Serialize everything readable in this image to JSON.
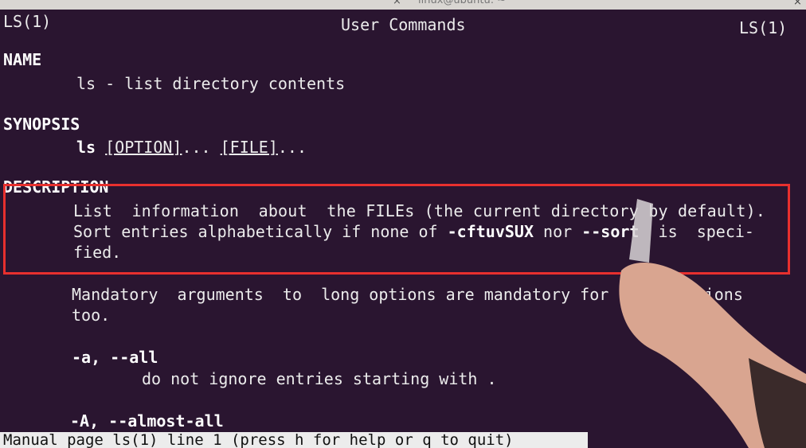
{
  "window": {
    "title": "linux@ubuntu: ~",
    "tab_close_glyph": "×",
    "close_glyph": "×"
  },
  "header": {
    "left": "LS(1)",
    "center": "User Commands",
    "right": "LS(1)"
  },
  "name_section": {
    "heading": "NAME",
    "text": "ls - list directory contents"
  },
  "synopsis": {
    "heading": "SYNOPSIS",
    "cmd": "ls",
    "option": "[OPTION]",
    "dots1": "...",
    "file": "[FILE]",
    "dots2": "..."
  },
  "description": {
    "heading": "DESCRIPTION",
    "line1": "List  information  about  the FILEs (the current directory by default).",
    "line2_pre": "Sort entries alphabetically if none of ",
    "flags": "-cftuvSUX",
    "nor": " nor ",
    "sort": "--sort",
    "line2_post": "  is  speci-",
    "line3": "fied."
  },
  "mandatory": {
    "line1": "Mandatory  arguments  to  long options are mandatory for short options",
    "line2": "too."
  },
  "options": [
    {
      "flag": "-a, --all",
      "desc": "do not ignore entries starting with ."
    },
    {
      "flag": "-A, --almost-all",
      "desc": ""
    }
  ],
  "status_bar": "Manual page ls(1) line 1 (press h for help or q to quit)",
  "colors": {
    "terminal_bg": "#2a1530",
    "text": "#ececec",
    "highlight": "#e8302e",
    "status_bg": "#ececec"
  }
}
